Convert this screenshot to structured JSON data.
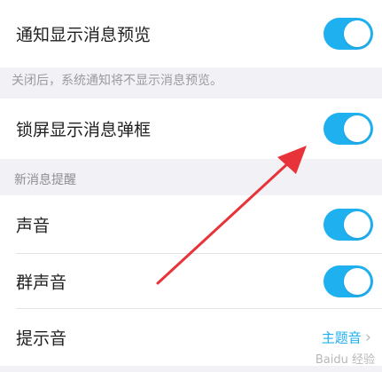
{
  "settings": {
    "preview_label": "通知显示消息预览",
    "preview_hint": "关闭后，系统通知将不显示消息预览。",
    "lockscreen_popup_label": "锁屏显示消息弹框",
    "new_message_section_title": "新消息提醒",
    "sound_label": "声音",
    "group_sound_label": "群声音",
    "alert_tone_label": "提示音",
    "alert_tone_value": "主题音"
  },
  "toggles": {
    "preview": true,
    "lockscreen_popup": true,
    "sound": true,
    "group_sound": true
  },
  "colors": {
    "accent": "#1fb0f0",
    "arrow": "#e8333a",
    "background": "#f2f2f6"
  },
  "watermark": "Baidu 经验"
}
